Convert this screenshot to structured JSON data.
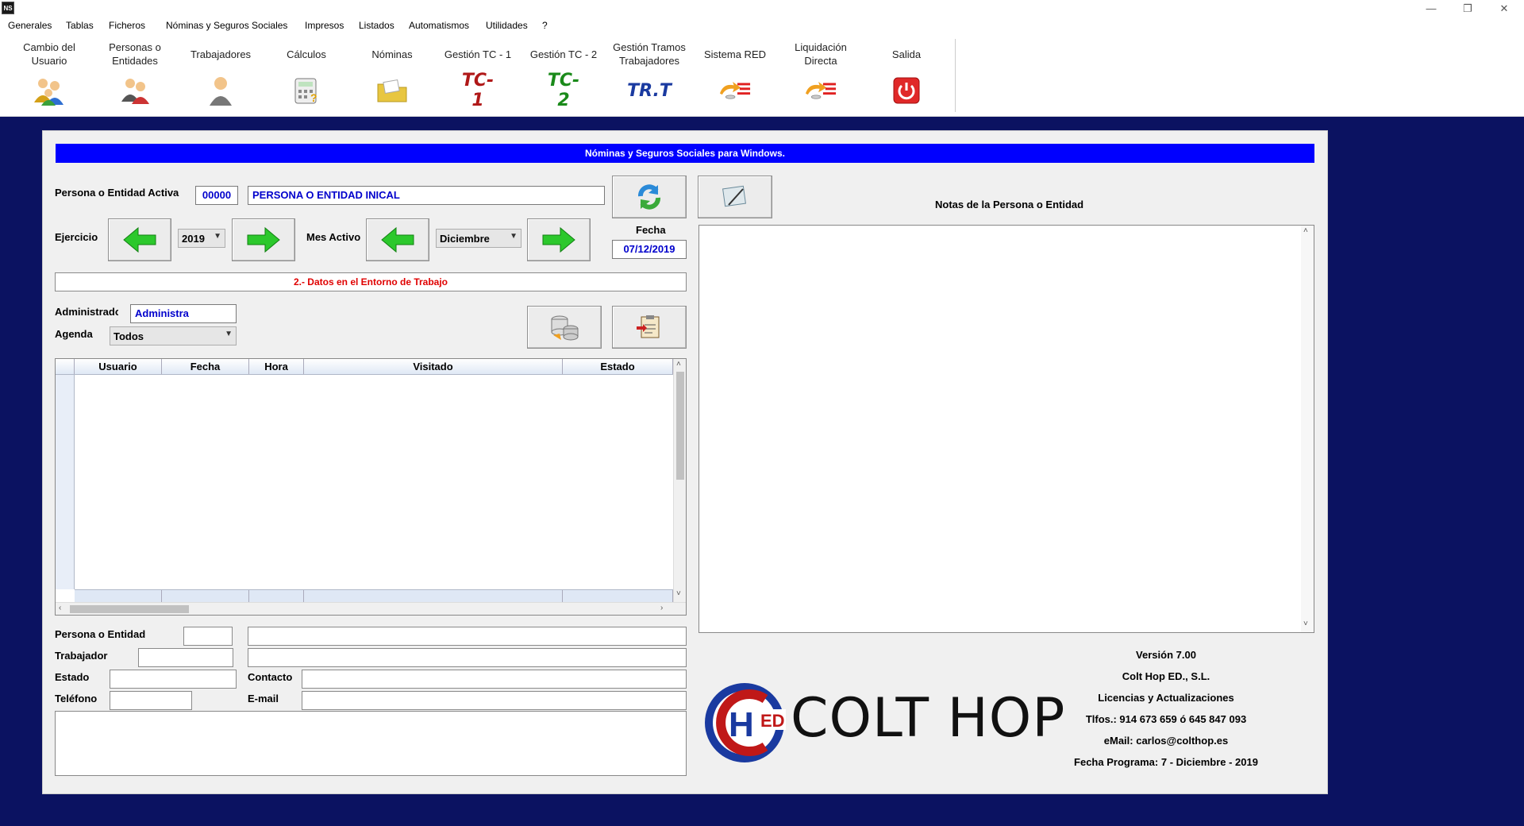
{
  "window": {
    "app_icon": "NS",
    "minimize": "—",
    "restore": "❐",
    "close": "✕"
  },
  "menu": [
    {
      "label": "Generales"
    },
    {
      "label": "Tablas"
    },
    {
      "label": "Ficheros"
    },
    {
      "label": "Nóminas y Seguros Sociales"
    },
    {
      "label": "Impresos"
    },
    {
      "label": "Listados"
    },
    {
      "label": "Automatismos"
    },
    {
      "label": "Utilidades"
    },
    {
      "label": "?"
    }
  ],
  "toolbar": [
    {
      "label": "Cambio del Usuario",
      "icon": "users-icon"
    },
    {
      "label": "Personas o Entidades",
      "icon": "entities-icon"
    },
    {
      "label": "Trabajadores",
      "icon": "worker-icon"
    },
    {
      "label": "Cálculos",
      "icon": "calculator-icon"
    },
    {
      "label": "Nóminas",
      "icon": "folder-icon"
    },
    {
      "label": "Gestión TC - 1",
      "icon_text": "TC-1",
      "color": "#b01818"
    },
    {
      "label": "Gestión TC - 2",
      "icon_text": "TC-2",
      "color": "#1a8a1a"
    },
    {
      "label": "Gestión Tramos Trabajadores",
      "icon_text": "TR.T",
      "color": "#1a3aa0"
    },
    {
      "label": "Sistema RED",
      "icon": "network-icon"
    },
    {
      "label": "Liquidación Directa",
      "icon": "network-icon"
    },
    {
      "label": "Salida",
      "icon": "power-icon"
    }
  ],
  "banner": "Nóminas y Seguros Sociales para Windows.",
  "persona": {
    "label": "Persona o Entidad Activa",
    "code": "00000",
    "name": "PERSONA O ENTIDAD INICAL"
  },
  "ejercicio": {
    "label": "Ejercicio",
    "value": "2019"
  },
  "mes": {
    "label": "Mes Activo",
    "value": "Diciembre"
  },
  "fecha": {
    "label": "Fecha",
    "value": "07/12/2019"
  },
  "entorno": "2.- Datos en el Entorno de Trabajo",
  "administrador": {
    "label": "Administrador",
    "value": "Administra"
  },
  "agenda": {
    "label": "Agenda",
    "value": "Todos"
  },
  "grid": {
    "columns": [
      "Usuario",
      "Fecha",
      "Hora",
      "Visitado",
      "Estado"
    ]
  },
  "notes_title": "Notas de la Persona o Entidad",
  "details": {
    "persona_label": "Persona o Entidad",
    "trabajador_label": "Trabajador",
    "estado_label": "Estado",
    "contacto_label": "Contacto",
    "telefono_label": "Teléfono",
    "email_label": "E-mail"
  },
  "info": {
    "version": "Versión 7.00",
    "company": "Colt Hop ED., S.L.",
    "licencias": "Licencias y Actualizaciones",
    "tlfos": "Tlfos.: 914 673 659 ó 645 847 093",
    "email": "eMail: carlos@colthop.es",
    "fecha_programa": "Fecha Programa:  7 - Diciembre - 2019"
  },
  "logo": {
    "text": "COLT HOP",
    "letters": "H",
    "ed": "ED"
  }
}
